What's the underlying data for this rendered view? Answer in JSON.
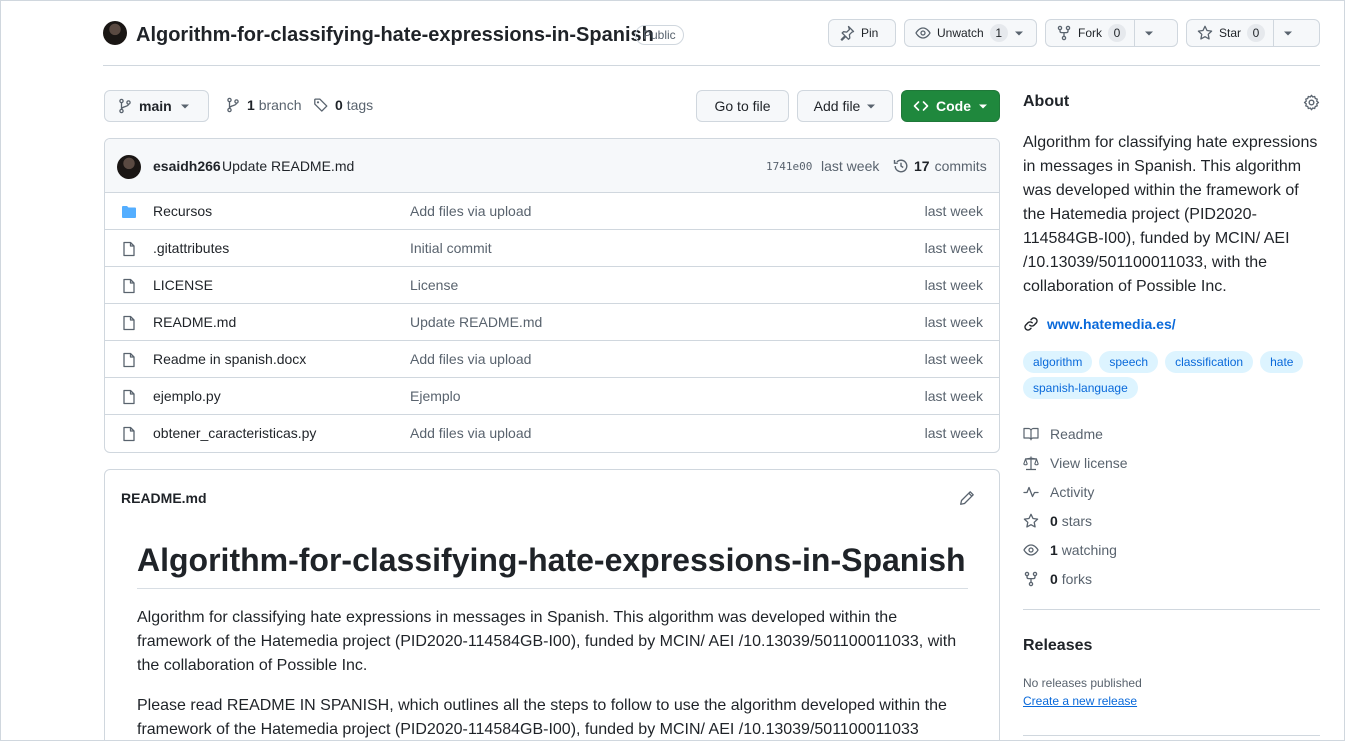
{
  "repo": {
    "title": "Algorithm-for-classifying-hate-expressions-in-Spanish",
    "visibility": "Public"
  },
  "header_actions": {
    "pin": "Pin",
    "unwatch": "Unwatch",
    "watch_count": "1",
    "fork": "Fork",
    "fork_count": "0",
    "star": "Star",
    "star_count": "0"
  },
  "toolbar": {
    "branch": "main",
    "branch_count": "1",
    "branch_label": "branch",
    "tag_count": "0",
    "tag_label": "tags",
    "go_to_file": "Go to file",
    "add_file": "Add file",
    "code": "Code"
  },
  "latest_commit": {
    "author": "esaidh266",
    "message": "Update README.md",
    "sha": "1741e00",
    "time": "last week",
    "count": "17",
    "count_label": "commits"
  },
  "files": [
    {
      "name": "Recursos",
      "type": "folder",
      "message": "Add files via upload",
      "time": "last week"
    },
    {
      "name": ".gitattributes",
      "type": "file",
      "message": "Initial commit",
      "time": "last week"
    },
    {
      "name": "LICENSE",
      "type": "file",
      "message": "License",
      "time": "last week"
    },
    {
      "name": "README.md",
      "type": "file",
      "message": "Update README.md",
      "time": "last week"
    },
    {
      "name": "Readme in spanish.docx",
      "type": "file",
      "message": "Add files via upload",
      "time": "last week"
    },
    {
      "name": "ejemplo.py",
      "type": "file",
      "message": "Ejemplo",
      "time": "last week"
    },
    {
      "name": "obtener_caracteristicas.py",
      "type": "file",
      "message": "Add files via upload",
      "time": "last week"
    }
  ],
  "readme": {
    "label": "README.md",
    "heading": "Algorithm-for-classifying-hate-expressions-in-Spanish",
    "para1": "Algorithm for classifying hate expressions in messages in Spanish. This algorithm was developed within the framework of the Hatemedia project (PID2020-114584GB-I00), funded by MCIN/ AEI /10.13039/501100011033, with the collaboration of Possible Inc.",
    "para2": "Please read README IN SPANISH, which outlines all the steps to follow to use the algorithm developed within the framework of the Hatemedia project (PID2020-114584GB-I00), funded by MCIN/ AEI /10.13039/501100011033"
  },
  "about": {
    "title": "About",
    "description": "Algorithm for classifying hate expressions in messages in Spanish. This algorithm was developed within the framework of the Hatemedia project (PID2020-114584GB-I00), funded by MCIN/ AEI /10.13039/501100011033, with the collaboration of Possible Inc.",
    "website": "www.hatemedia.es/",
    "topics": [
      "algorithm",
      "speech",
      "classification",
      "hate",
      "spanish-language"
    ],
    "readme": "Readme",
    "license": "View license",
    "activity": "Activity",
    "stars_count": "0",
    "stars_label": "stars",
    "watching_count": "1",
    "watching_label": "watching",
    "forks_count": "0",
    "forks_label": "forks"
  },
  "releases": {
    "title": "Releases",
    "none": "No releases published",
    "create": "Create a new release"
  },
  "colors": {
    "accent": "#0969da",
    "code_button": "#1f883d",
    "folder": "#54aeff",
    "topic_bg": "#ddf4ff"
  }
}
